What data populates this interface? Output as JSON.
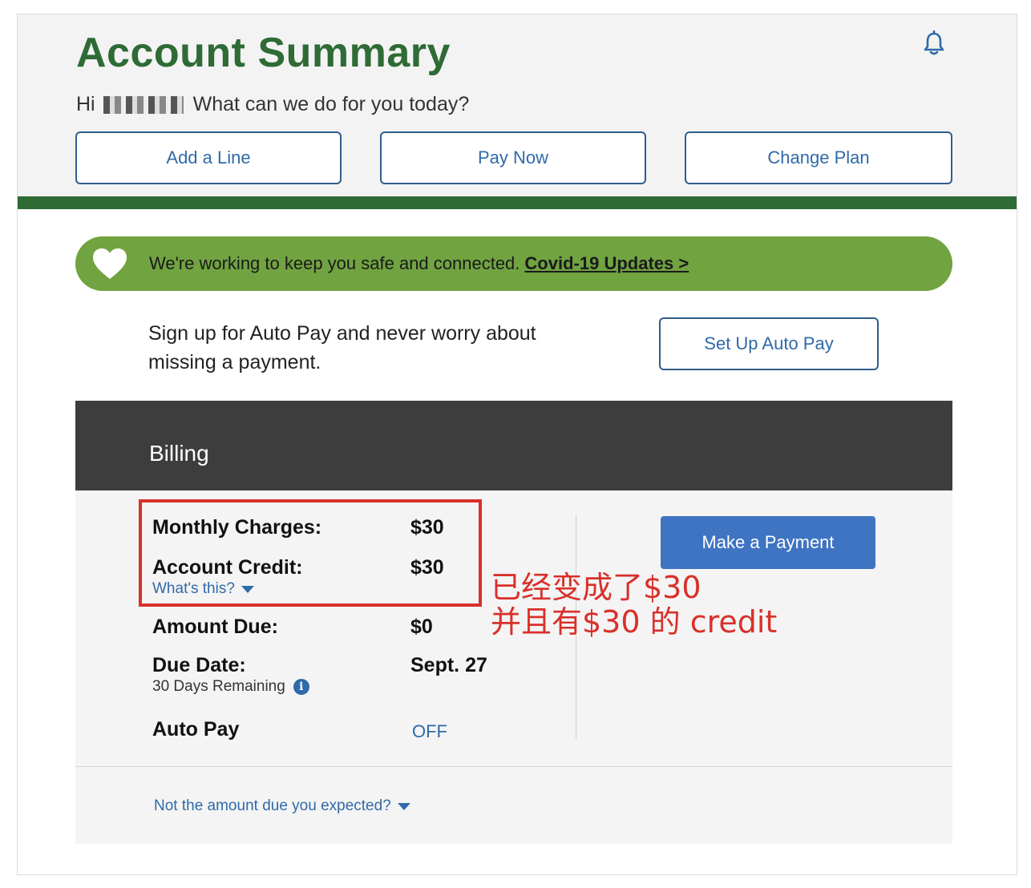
{
  "header": {
    "title": "Account Summary",
    "greeting_prefix": "Hi",
    "greeting_suffix": "What can we do for you today?",
    "actions": [
      {
        "label": "Add a Line"
      },
      {
        "label": "Pay Now"
      },
      {
        "label": "Change Plan"
      }
    ],
    "bell_icon": "bell-icon"
  },
  "covid": {
    "icon": "heart-icon",
    "text": "We're working to keep you safe and connected.",
    "link": "Covid-19 Updates >"
  },
  "autopay": {
    "text": "Sign up for Auto Pay and never worry about missing a payment.",
    "button": "Set Up Auto Pay"
  },
  "billing": {
    "title": "Billing",
    "monthly_charges_label": "Monthly Charges:",
    "monthly_charges_value": "$30",
    "account_credit_label": "Account Credit:",
    "account_credit_value": "$30",
    "whats_this": "What's this?",
    "amount_due_label": "Amount Due:",
    "amount_due_value": "$0",
    "due_date_label": "Due Date:",
    "due_date_value": "Sept. 27",
    "days_remaining": "30 Days Remaining",
    "autopay_label": "Auto Pay",
    "autopay_value": "OFF",
    "make_payment": "Make a Payment",
    "expected_link": "Not the amount due you expected?"
  },
  "annotation": {
    "line1": "已经变成了$30",
    "line2": "并且有$30 的 credit",
    "color": "#d9302a"
  },
  "colors": {
    "brand_green": "#2e6b35",
    "banner_green": "#71a341",
    "link_blue": "#2f6aa8",
    "button_blue": "#3f74c2",
    "billing_header": "#3d3d3d"
  }
}
